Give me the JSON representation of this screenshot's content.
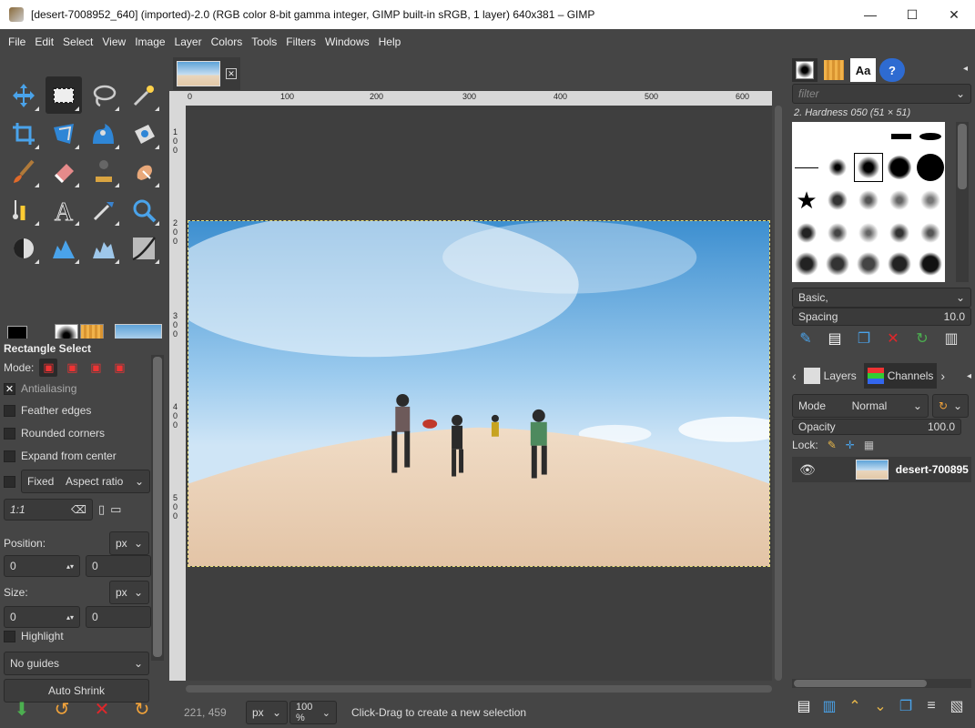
{
  "window": {
    "title": "[desert-7008952_640] (imported)-2.0 (RGB color 8-bit gamma integer, GIMP built-in sRGB, 1 layer) 640x381 – GIMP",
    "minimize": "—",
    "maximize": "☐",
    "close": "✕"
  },
  "menubar": [
    "File",
    "Edit",
    "Select",
    "View",
    "Image",
    "Layer",
    "Colors",
    "Tools",
    "Filters",
    "Windows",
    "Help"
  ],
  "toolbox": {
    "tools": [
      "move-tool",
      "rectangle-select-tool",
      "free-select-tool",
      "fuzzy-select-tool",
      "crop-tool",
      "unified-transform-tool",
      "warp-transform-tool",
      "handle-transform-tool",
      "paintbrush-tool",
      "eraser-tool",
      "clone-tool",
      "smudge-tool",
      "paths-tool",
      "text-tool",
      "color-picker-tool",
      "zoom-tool",
      "levels-tool",
      "histogram-tool",
      "curves-tool-a",
      "curves-tool-b"
    ],
    "colors": {
      "fg": "#000000",
      "bg": "#ffffff",
      "accent_red": "#e0262a"
    }
  },
  "tool_options": {
    "title": "Rectangle Select",
    "mode_label": "Mode:",
    "antialiasing": "Antialiasing",
    "feather": "Feather edges",
    "rounded": "Rounded corners",
    "expand": "Expand from center",
    "fixed": "Fixed",
    "aspect": "Aspect ratio",
    "ratio": "1:1",
    "position_label": "Position:",
    "size_label": "Size:",
    "unit": "px",
    "pos_x": "0",
    "pos_y": "0",
    "size_x": "0",
    "size_y": "0",
    "highlight": "Highlight",
    "guides": "No guides",
    "auto_shrink": "Auto Shrink"
  },
  "image_window": {
    "ruler_top": [
      "0",
      "100",
      "200",
      "300",
      "400",
      "500",
      "600"
    ],
    "ruler_left": [
      "1 0 0",
      "2 0 0",
      "3 0 0",
      "4 0 0",
      "5 0 0"
    ],
    "status": {
      "coords": "221, 459",
      "unit": "px",
      "zoom": "100 %",
      "message": "Click-Drag to create a new selection"
    }
  },
  "brushes": {
    "filter_placeholder": "filter",
    "brush_name": "2. Hardness 050 (51 × 51)",
    "preset": "Basic,",
    "spacing_label": "Spacing",
    "spacing_value": "10.0",
    "font_tab": "Aa",
    "help_tab": "?"
  },
  "layers": {
    "tab_layers": "Layers",
    "tab_channels": "Channels",
    "mode_label": "Mode",
    "mode_value": "Normal",
    "opacity_label": "Opacity",
    "opacity_value": "100.0",
    "lock_label": "Lock:",
    "layer_name": "desert-700895"
  }
}
